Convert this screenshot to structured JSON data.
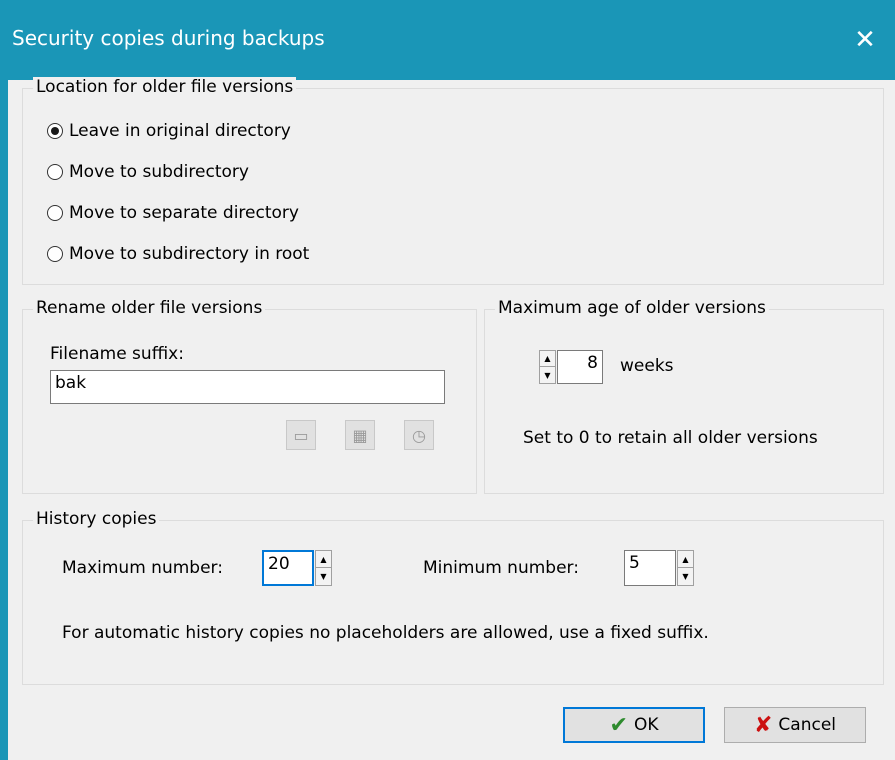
{
  "window": {
    "title": "Security copies during backups",
    "close_glyph": "✕"
  },
  "location": {
    "legend": "Location for older file versions",
    "options": [
      {
        "label": "Leave in original directory",
        "checked": true
      },
      {
        "label": "Move to subdirectory",
        "checked": false
      },
      {
        "label": "Move to separate directory",
        "checked": false
      },
      {
        "label": "Move to subdirectory in root",
        "checked": false
      }
    ]
  },
  "rename": {
    "legend": "Rename older file versions",
    "suffix_label": "Filename suffix:",
    "suffix_value": "bak",
    "icons": [
      "insert-placeholder-icon",
      "date-placeholder-icon",
      "time-placeholder-icon"
    ]
  },
  "max_age": {
    "legend": "Maximum age of older versions",
    "value": "8",
    "unit": "weeks",
    "hint": "Set to 0 to retain all older versions"
  },
  "history": {
    "legend": "History copies",
    "max_label": "Maximum number:",
    "max_value": "20",
    "min_label": "Minimum number:",
    "min_value": "5",
    "note": "For automatic history copies no placeholders are allowed, use a fixed suffix."
  },
  "buttons": {
    "ok_label": "OK",
    "cancel_label": "Cancel",
    "ok_icon_color": "#2e8b2e",
    "cancel_icon_color": "#cc1111"
  }
}
